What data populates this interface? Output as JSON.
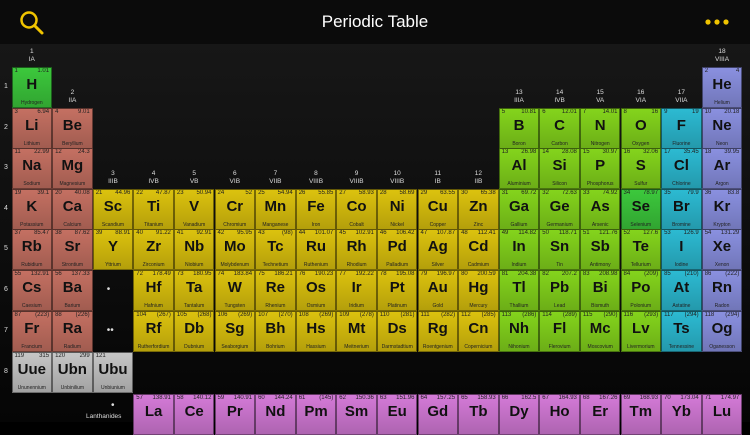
{
  "header": {
    "title": "Periodic Table"
  },
  "group_labels": [
    {
      "g": 1,
      "num": "1",
      "roman": "IA"
    },
    {
      "g": 2,
      "num": "2",
      "roman": "IIA"
    },
    {
      "g": 3,
      "num": "3",
      "roman": "IIIB"
    },
    {
      "g": 4,
      "num": "4",
      "roman": "IVB"
    },
    {
      "g": 5,
      "num": "5",
      "roman": "VB"
    },
    {
      "g": 6,
      "num": "6",
      "roman": "VIB"
    },
    {
      "g": 7,
      "num": "7",
      "roman": "VIIB"
    },
    {
      "g": 8,
      "num": "8",
      "roman": "VIIIB"
    },
    {
      "g": 9,
      "num": "9",
      "roman": "VIIIB"
    },
    {
      "g": 10,
      "num": "10",
      "roman": "VIIIB"
    },
    {
      "g": 11,
      "num": "11",
      "roman": "IB"
    },
    {
      "g": 12,
      "num": "12",
      "roman": "IIB"
    },
    {
      "g": 13,
      "num": "13",
      "roman": "IIIA"
    },
    {
      "g": 14,
      "num": "14",
      "roman": "IVB"
    },
    {
      "g": 15,
      "num": "15",
      "roman": "VA"
    },
    {
      "g": 16,
      "num": "16",
      "roman": "VIA"
    },
    {
      "g": 17,
      "num": "17",
      "roman": "VIIA"
    },
    {
      "g": 18,
      "num": "18",
      "roman": "VIIIA"
    }
  ],
  "period_labels": [
    "1",
    "2",
    "3",
    "4",
    "5",
    "6",
    "7",
    "8"
  ],
  "lanthanides_label": "Lanthanides",
  "colors": {
    "nonmetal": "#3cc83c",
    "alkali": "#c47062",
    "alkaline": "#c47062",
    "transition": "#dcc20e",
    "poor": "#84d41c",
    "metalloid": "#84d41c",
    "halogen": "#2cbad2",
    "noble": "#8a90e0",
    "unknown": "#c6c6c6",
    "lanthanide": "#d47ad8"
  },
  "elements": [
    {
      "n": "1",
      "s": "H",
      "name": "Hydrogen",
      "m": "1.01",
      "g": 1,
      "p": 1,
      "c": "nonmetal"
    },
    {
      "n": "2",
      "s": "He",
      "name": "Helium",
      "m": "4",
      "g": 18,
      "p": 1,
      "c": "noble"
    },
    {
      "n": "3",
      "s": "Li",
      "name": "Lithium",
      "m": "6.94",
      "g": 1,
      "p": 2,
      "c": "alkali"
    },
    {
      "n": "4",
      "s": "Be",
      "name": "Beryllium",
      "m": "9.01",
      "g": 2,
      "p": 2,
      "c": "alkaline"
    },
    {
      "n": "5",
      "s": "B",
      "name": "Boron",
      "m": "10.81",
      "g": 13,
      "p": 2,
      "c": "metalloid"
    },
    {
      "n": "6",
      "s": "C",
      "name": "Carbon",
      "m": "12.01",
      "g": 14,
      "p": 2,
      "c": "poor"
    },
    {
      "n": "7",
      "s": "N",
      "name": "Nitrogen",
      "m": "14.01",
      "g": 15,
      "p": 2,
      "c": "poor"
    },
    {
      "n": "8",
      "s": "O",
      "name": "Oxygen",
      "m": "16",
      "g": 16,
      "p": 2,
      "c": "poor"
    },
    {
      "n": "9",
      "s": "F",
      "name": "Fluorine",
      "m": "19",
      "g": 17,
      "p": 2,
      "c": "halogen"
    },
    {
      "n": "10",
      "s": "Ne",
      "name": "Neon",
      "m": "20.18",
      "g": 18,
      "p": 2,
      "c": "noble"
    },
    {
      "n": "11",
      "s": "Na",
      "name": "Sodium",
      "m": "22.99",
      "g": 1,
      "p": 3,
      "c": "alkali"
    },
    {
      "n": "12",
      "s": "Mg",
      "name": "Magnesium",
      "m": "24.3",
      "g": 2,
      "p": 3,
      "c": "alkaline"
    },
    {
      "n": "13",
      "s": "Al",
      "name": "Aluminium",
      "m": "26.98",
      "g": 13,
      "p": 3,
      "c": "poor"
    },
    {
      "n": "14",
      "s": "Si",
      "name": "Silicon",
      "m": "28.08",
      "g": 14,
      "p": 3,
      "c": "metalloid"
    },
    {
      "n": "15",
      "s": "P",
      "name": "Phosphorus",
      "m": "30.97",
      "g": 15,
      "p": 3,
      "c": "poor"
    },
    {
      "n": "16",
      "s": "S",
      "name": "Sulfur",
      "m": "32.06",
      "g": 16,
      "p": 3,
      "c": "poor"
    },
    {
      "n": "17",
      "s": "Cl",
      "name": "Chlorine",
      "m": "35.45",
      "g": 17,
      "p": 3,
      "c": "halogen"
    },
    {
      "n": "18",
      "s": "Ar",
      "name": "Argon",
      "m": "39.95",
      "g": 18,
      "p": 3,
      "c": "noble"
    },
    {
      "n": "19",
      "s": "K",
      "name": "Potassium",
      "m": "39.1",
      "g": 1,
      "p": 4,
      "c": "alkali"
    },
    {
      "n": "20",
      "s": "Ca",
      "name": "Calcium",
      "m": "40.08",
      "g": 2,
      "p": 4,
      "c": "alkaline"
    },
    {
      "n": "21",
      "s": "Sc",
      "name": "Scandium",
      "m": "44.96",
      "g": 3,
      "p": 4,
      "c": "transition"
    },
    {
      "n": "22",
      "s": "Ti",
      "name": "Titanium",
      "m": "47.87",
      "g": 4,
      "p": 4,
      "c": "transition"
    },
    {
      "n": "23",
      "s": "V",
      "name": "Vanadium",
      "m": "50.94",
      "g": 5,
      "p": 4,
      "c": "transition"
    },
    {
      "n": "24",
      "s": "Cr",
      "name": "Chromium",
      "m": "52",
      "g": 6,
      "p": 4,
      "c": "transition"
    },
    {
      "n": "25",
      "s": "Mn",
      "name": "Manganese",
      "m": "54.94",
      "g": 7,
      "p": 4,
      "c": "transition"
    },
    {
      "n": "26",
      "s": "Fe",
      "name": "Iron",
      "m": "55.85",
      "g": 8,
      "p": 4,
      "c": "transition"
    },
    {
      "n": "27",
      "s": "Co",
      "name": "Cobalt",
      "m": "58.93",
      "g": 9,
      "p": 4,
      "c": "transition"
    },
    {
      "n": "28",
      "s": "Ni",
      "name": "Nickel",
      "m": "58.69",
      "g": 10,
      "p": 4,
      "c": "transition"
    },
    {
      "n": "29",
      "s": "Cu",
      "name": "Copper",
      "m": "63.55",
      "g": 11,
      "p": 4,
      "c": "transition"
    },
    {
      "n": "30",
      "s": "Zn",
      "name": "Zinc",
      "m": "65.38",
      "g": 12,
      "p": 4,
      "c": "transition"
    },
    {
      "n": "31",
      "s": "Ga",
      "name": "Gallium",
      "m": "69.72",
      "g": 13,
      "p": 4,
      "c": "poor"
    },
    {
      "n": "32",
      "s": "Ge",
      "name": "Germanium",
      "m": "72.63",
      "g": 14,
      "p": 4,
      "c": "metalloid"
    },
    {
      "n": "33",
      "s": "As",
      "name": "Arsenic",
      "m": "74.92",
      "g": 15,
      "p": 4,
      "c": "metalloid"
    },
    {
      "n": "34",
      "s": "Se",
      "name": "Selenium",
      "m": "78.97",
      "g": 16,
      "p": 4,
      "c": "nonmetal"
    },
    {
      "n": "35",
      "s": "Br",
      "name": "Bromine",
      "m": "79.9",
      "g": 17,
      "p": 4,
      "c": "halogen"
    },
    {
      "n": "36",
      "s": "Kr",
      "name": "Krypton",
      "m": "83.8",
      "g": 18,
      "p": 4,
      "c": "noble"
    },
    {
      "n": "37",
      "s": "Rb",
      "name": "Rubidium",
      "m": "85.47",
      "g": 1,
      "p": 5,
      "c": "alkali"
    },
    {
      "n": "38",
      "s": "Sr",
      "name": "Strontium",
      "m": "87.62",
      "g": 2,
      "p": 5,
      "c": "alkaline"
    },
    {
      "n": "39",
      "s": "Y",
      "name": "Yttrium",
      "m": "88.91",
      "g": 3,
      "p": 5,
      "c": "transition"
    },
    {
      "n": "40",
      "s": "Zr",
      "name": "Zirconium",
      "m": "91.22",
      "g": 4,
      "p": 5,
      "c": "transition"
    },
    {
      "n": "41",
      "s": "Nb",
      "name": "Niobium",
      "m": "92.91",
      "g": 5,
      "p": 5,
      "c": "transition"
    },
    {
      "n": "42",
      "s": "Mo",
      "name": "Molybdenum",
      "m": "95.95",
      "g": 6,
      "p": 5,
      "c": "transition"
    },
    {
      "n": "43",
      "s": "Tc",
      "name": "Technetium",
      "m": "(98)",
      "g": 7,
      "p": 5,
      "c": "transition"
    },
    {
      "n": "44",
      "s": "Ru",
      "name": "Ruthenium",
      "m": "101.07",
      "g": 8,
      "p": 5,
      "c": "transition"
    },
    {
      "n": "45",
      "s": "Rh",
      "name": "Rhodium",
      "m": "102.91",
      "g": 9,
      "p": 5,
      "c": "transition"
    },
    {
      "n": "46",
      "s": "Pd",
      "name": "Palladium",
      "m": "106.42",
      "g": 10,
      "p": 5,
      "c": "transition"
    },
    {
      "n": "47",
      "s": "Ag",
      "name": "Silver",
      "m": "107.87",
      "g": 11,
      "p": 5,
      "c": "transition"
    },
    {
      "n": "48",
      "s": "Cd",
      "name": "Cadmium",
      "m": "112.41",
      "g": 12,
      "p": 5,
      "c": "transition"
    },
    {
      "n": "49",
      "s": "In",
      "name": "Indium",
      "m": "114.82",
      "g": 13,
      "p": 5,
      "c": "poor"
    },
    {
      "n": "50",
      "s": "Sn",
      "name": "Tin",
      "m": "118.71",
      "g": 14,
      "p": 5,
      "c": "poor"
    },
    {
      "n": "51",
      "s": "Sb",
      "name": "Antimony",
      "m": "121.76",
      "g": 15,
      "p": 5,
      "c": "metalloid"
    },
    {
      "n": "52",
      "s": "Te",
      "name": "Tellurium",
      "m": "127.6",
      "g": 16,
      "p": 5,
      "c": "metalloid"
    },
    {
      "n": "53",
      "s": "I",
      "name": "Iodine",
      "m": "126.9",
      "g": 17,
      "p": 5,
      "c": "halogen"
    },
    {
      "n": "54",
      "s": "Xe",
      "name": "Xenon",
      "m": "131.29",
      "g": 18,
      "p": 5,
      "c": "noble"
    },
    {
      "n": "55",
      "s": "Cs",
      "name": "Caesium",
      "m": "132.91",
      "g": 1,
      "p": 6,
      "c": "alkali"
    },
    {
      "n": "56",
      "s": "Ba",
      "name": "Barium",
      "m": "137.33",
      "g": 2,
      "p": 6,
      "c": "alkaline"
    },
    {
      "n": "72",
      "s": "Hf",
      "name": "Hafnium",
      "m": "178.49",
      "g": 4,
      "p": 6,
      "c": "transition"
    },
    {
      "n": "73",
      "s": "Ta",
      "name": "Tantalum",
      "m": "180.95",
      "g": 5,
      "p": 6,
      "c": "transition"
    },
    {
      "n": "74",
      "s": "W",
      "name": "Tungsten",
      "m": "183.84",
      "g": 6,
      "p": 6,
      "c": "transition"
    },
    {
      "n": "75",
      "s": "Re",
      "name": "Rhenium",
      "m": "186.21",
      "g": 7,
      "p": 6,
      "c": "transition"
    },
    {
      "n": "76",
      "s": "Os",
      "name": "Osmium",
      "m": "190.23",
      "g": 8,
      "p": 6,
      "c": "transition"
    },
    {
      "n": "77",
      "s": "Ir",
      "name": "Iridium",
      "m": "192.22",
      "g": 9,
      "p": 6,
      "c": "transition"
    },
    {
      "n": "78",
      "s": "Pt",
      "name": "Platinum",
      "m": "195.08",
      "g": 10,
      "p": 6,
      "c": "transition"
    },
    {
      "n": "79",
      "s": "Au",
      "name": "Gold",
      "m": "196.97",
      "g": 11,
      "p": 6,
      "c": "transition"
    },
    {
      "n": "80",
      "s": "Hg",
      "name": "Mercury",
      "m": "200.59",
      "g": 12,
      "p": 6,
      "c": "transition"
    },
    {
      "n": "81",
      "s": "Tl",
      "name": "Thallium",
      "m": "204.38",
      "g": 13,
      "p": 6,
      "c": "poor"
    },
    {
      "n": "82",
      "s": "Pb",
      "name": "Lead",
      "m": "207.2",
      "g": 14,
      "p": 6,
      "c": "poor"
    },
    {
      "n": "83",
      "s": "Bi",
      "name": "Bismuth",
      "m": "208.98",
      "g": 15,
      "p": 6,
      "c": "poor"
    },
    {
      "n": "84",
      "s": "Po",
      "name": "Polonium",
      "m": "(209)",
      "g": 16,
      "p": 6,
      "c": "poor"
    },
    {
      "n": "85",
      "s": "At",
      "name": "Astatine",
      "m": "(210)",
      "g": 17,
      "p": 6,
      "c": "halogen"
    },
    {
      "n": "86",
      "s": "Rn",
      "name": "Radon",
      "m": "(222)",
      "g": 18,
      "p": 6,
      "c": "noble"
    },
    {
      "n": "87",
      "s": "Fr",
      "name": "Francium",
      "m": "(223)",
      "g": 1,
      "p": 7,
      "c": "alkali"
    },
    {
      "n": "88",
      "s": "Ra",
      "name": "Radium",
      "m": "(226)",
      "g": 2,
      "p": 7,
      "c": "alkaline"
    },
    {
      "n": "104",
      "s": "Rf",
      "name": "Rutherfordium",
      "m": "(267)",
      "g": 4,
      "p": 7,
      "c": "transition"
    },
    {
      "n": "105",
      "s": "Db",
      "name": "Dubnium",
      "m": "(268)",
      "g": 5,
      "p": 7,
      "c": "transition"
    },
    {
      "n": "106",
      "s": "Sg",
      "name": "Seaborgium",
      "m": "(269)",
      "g": 6,
      "p": 7,
      "c": "transition"
    },
    {
      "n": "107",
      "s": "Bh",
      "name": "Bohrium",
      "m": "(270)",
      "g": 7,
      "p": 7,
      "c": "transition"
    },
    {
      "n": "108",
      "s": "Hs",
      "name": "Hassium",
      "m": "(269)",
      "g": 8,
      "p": 7,
      "c": "transition"
    },
    {
      "n": "109",
      "s": "Mt",
      "name": "Meitnerium",
      "m": "(278)",
      "g": 9,
      "p": 7,
      "c": "transition"
    },
    {
      "n": "110",
      "s": "Ds",
      "name": "Darmstadtium",
      "m": "(281)",
      "g": 10,
      "p": 7,
      "c": "transition"
    },
    {
      "n": "111",
      "s": "Rg",
      "name": "Roentgenium",
      "m": "(282)",
      "g": 11,
      "p": 7,
      "c": "transition"
    },
    {
      "n": "112",
      "s": "Cn",
      "name": "Copernicium",
      "m": "(285)",
      "g": 12,
      "p": 7,
      "c": "transition"
    },
    {
      "n": "113",
      "s": "Nh",
      "name": "Nihonium",
      "m": "(286)",
      "g": 13,
      "p": 7,
      "c": "poor"
    },
    {
      "n": "114",
      "s": "Fl",
      "name": "Flerovium",
      "m": "(289)",
      "g": 14,
      "p": 7,
      "c": "poor"
    },
    {
      "n": "115",
      "s": "Mc",
      "name": "Moscovium",
      "m": "(290)",
      "g": 15,
      "p": 7,
      "c": "poor"
    },
    {
      "n": "116",
      "s": "Lv",
      "name": "Livermorium",
      "m": "(293)",
      "g": 16,
      "p": 7,
      "c": "poor"
    },
    {
      "n": "117",
      "s": "Ts",
      "name": "Tennessine",
      "m": "(294)",
      "g": 17,
      "p": 7,
      "c": "halogen"
    },
    {
      "n": "118",
      "s": "Og",
      "name": "Oganesson",
      "m": "(294)",
      "g": 18,
      "p": 7,
      "c": "noble"
    },
    {
      "n": "119",
      "s": "Uue",
      "name": "Ununennium",
      "m": "315",
      "g": 1,
      "p": 8,
      "c": "unknown"
    },
    {
      "n": "120",
      "s": "Ubn",
      "name": "Unbinilium",
      "m": "299",
      "g": 2,
      "p": 8,
      "c": "unknown"
    },
    {
      "n": "121",
      "s": "Ubu",
      "name": "Unbiunium",
      "m": "",
      "g": 3,
      "p": 8,
      "c": "unknown"
    }
  ],
  "lanthanides": [
    {
      "n": "57",
      "s": "La",
      "m": "138.91"
    },
    {
      "n": "58",
      "s": "Ce",
      "m": "140.12"
    },
    {
      "n": "59",
      "s": "Pr",
      "m": "140.91"
    },
    {
      "n": "60",
      "s": "Nd",
      "m": "144.24"
    },
    {
      "n": "61",
      "s": "Pm",
      "m": "(145)"
    },
    {
      "n": "62",
      "s": "Sm",
      "m": "150.36"
    },
    {
      "n": "63",
      "s": "Eu",
      "m": "151.96"
    },
    {
      "n": "64",
      "s": "Gd",
      "m": "157.25"
    },
    {
      "n": "65",
      "s": "Tb",
      "m": "158.93"
    },
    {
      "n": "66",
      "s": "Dy",
      "m": "162.5"
    },
    {
      "n": "67",
      "s": "Ho",
      "m": "164.93"
    },
    {
      "n": "68",
      "s": "Er",
      "m": "167.26"
    },
    {
      "n": "69",
      "s": "Tm",
      "m": "168.93"
    },
    {
      "n": "70",
      "s": "Yb",
      "m": "173.04"
    },
    {
      "n": "71",
      "s": "Lu",
      "m": "174.97"
    }
  ]
}
